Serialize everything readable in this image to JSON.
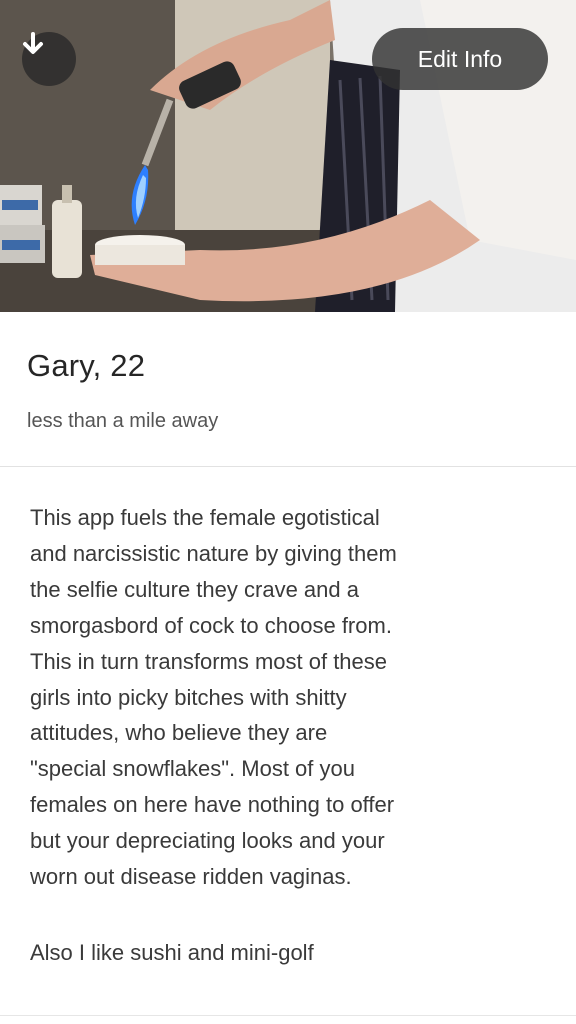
{
  "photo": {
    "download_icon": "arrow-down-icon",
    "edit_button_label": "Edit Info"
  },
  "profile": {
    "name_age": "Gary, 22",
    "distance": "less than a mile away"
  },
  "bio": {
    "lines": [
      "This app fuels the female egotistical",
      "and narcissistic nature by giving them",
      "the selfie culture they crave and a",
      "smorgasbord of cock to choose from.",
      "This in turn transforms most of these",
      "girls into picky bitches with shitty",
      "attitudes, who believe they are",
      "\"special snowflakes\". Most of you",
      "females on here have nothing to offer",
      "but your depreciating looks and your",
      "worn out disease ridden vaginas."
    ],
    "extra": "Also I like sushi and mini-golf"
  }
}
